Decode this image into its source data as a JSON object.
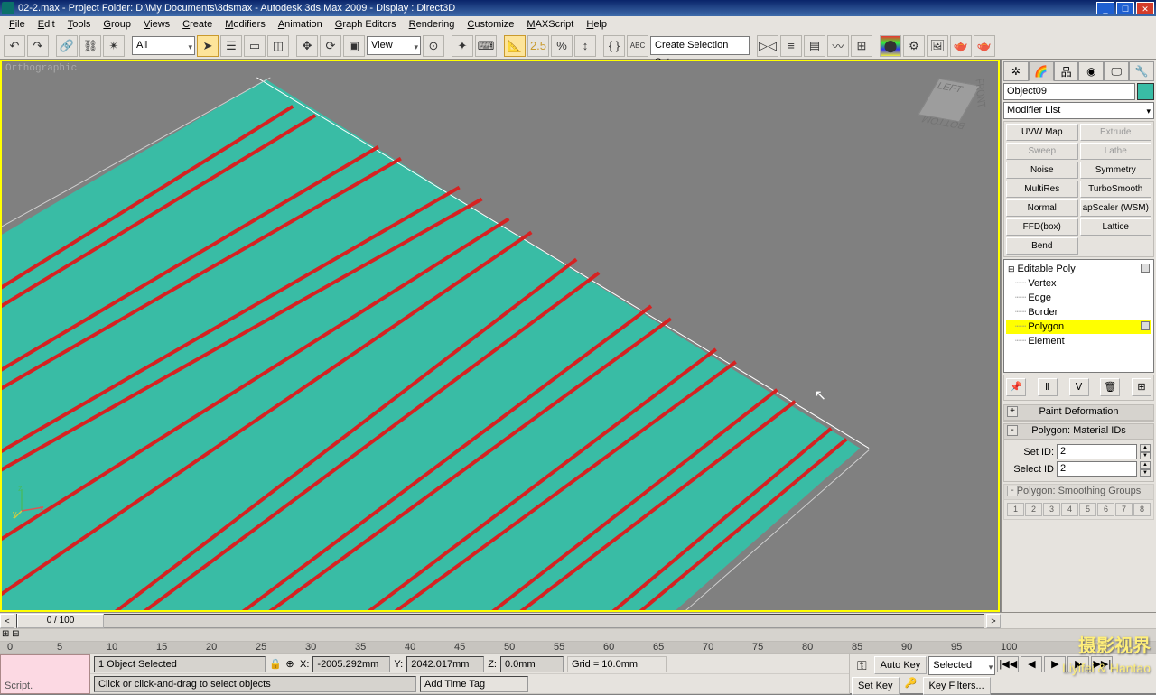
{
  "title": "02-2.max       - Project Folder: D:\\My Documents\\3dsmax    - Autodesk 3ds Max  2009        - Display : Direct3D",
  "menu": [
    "File",
    "Edit",
    "Tools",
    "Group",
    "Views",
    "Create",
    "Modifiers",
    "Animation",
    "Graph Editors",
    "Rendering",
    "Customize",
    "MAXScript",
    "Help"
  ],
  "toolbar": {
    "filter": "All",
    "snap_value": "2.5",
    "view_mode": "View",
    "sel_set": "Create Selection Set"
  },
  "viewport": {
    "label": "Orthographic"
  },
  "viewcube": {
    "left": "LEFT",
    "front": "FRONT",
    "bottom": "BOTTOM"
  },
  "cmd": {
    "object_name": "Object09",
    "object_color": "#39bca5",
    "modifier_list_label": "Modifier List",
    "mod_buttons": [
      {
        "l": "UVW Map",
        "d": false
      },
      {
        "l": "Extrude",
        "d": true
      },
      {
        "l": "Sweep",
        "d": true
      },
      {
        "l": "Lathe",
        "d": true
      },
      {
        "l": "Noise",
        "d": false
      },
      {
        "l": "Symmetry",
        "d": false
      },
      {
        "l": "MultiRes",
        "d": false
      },
      {
        "l": "TurboSmooth",
        "d": false
      },
      {
        "l": "Normal",
        "d": false
      },
      {
        "l": "apScaler (WSM)",
        "d": false
      },
      {
        "l": "FFD(box)",
        "d": false
      },
      {
        "l": "Lattice",
        "d": false
      },
      {
        "l": "Bend",
        "d": false
      }
    ],
    "stack": {
      "top": "Editable Poly",
      "subs": [
        "Vertex",
        "Edge",
        "Border",
        "Polygon",
        "Element"
      ],
      "selected": "Polygon"
    },
    "rollouts": {
      "paint_deform": "Paint Deformation",
      "poly_matid": "Polygon: Material IDs",
      "set_id_label": "Set ID:",
      "set_id_val": "2",
      "select_id_label": "Select ID",
      "select_id_val": "2",
      "poly_smooth": "Polygon: Smoothing Groups",
      "sg": [
        "1",
        "2",
        "3",
        "4",
        "5",
        "6",
        "7",
        "8"
      ]
    }
  },
  "timeline": {
    "thumb": "0 / 100",
    "ticks": [
      0,
      5,
      10,
      15,
      20,
      25,
      30,
      35,
      40,
      45,
      50,
      55,
      60,
      65,
      70,
      75,
      80,
      85,
      90,
      95,
      100
    ]
  },
  "status": {
    "script_label": "Script.",
    "sel": "1 Object Selected",
    "hint": "Click or click-and-drag to select objects",
    "x_label": "X:",
    "x": "-2005.292mm",
    "y_label": "Y:",
    "y": "2042.017mm",
    "z_label": "Z:",
    "z": "0.0mm",
    "grid": "Grid = 10.0mm",
    "add_tag": "Add Time Tag",
    "autokey": "Auto Key",
    "setkey": "Set Key",
    "selected_mode": "Selected",
    "keyfilters": "Key Filters..."
  },
  "watermark": {
    "big": "摄影视界",
    "small": "Liyifei & Hantao"
  }
}
